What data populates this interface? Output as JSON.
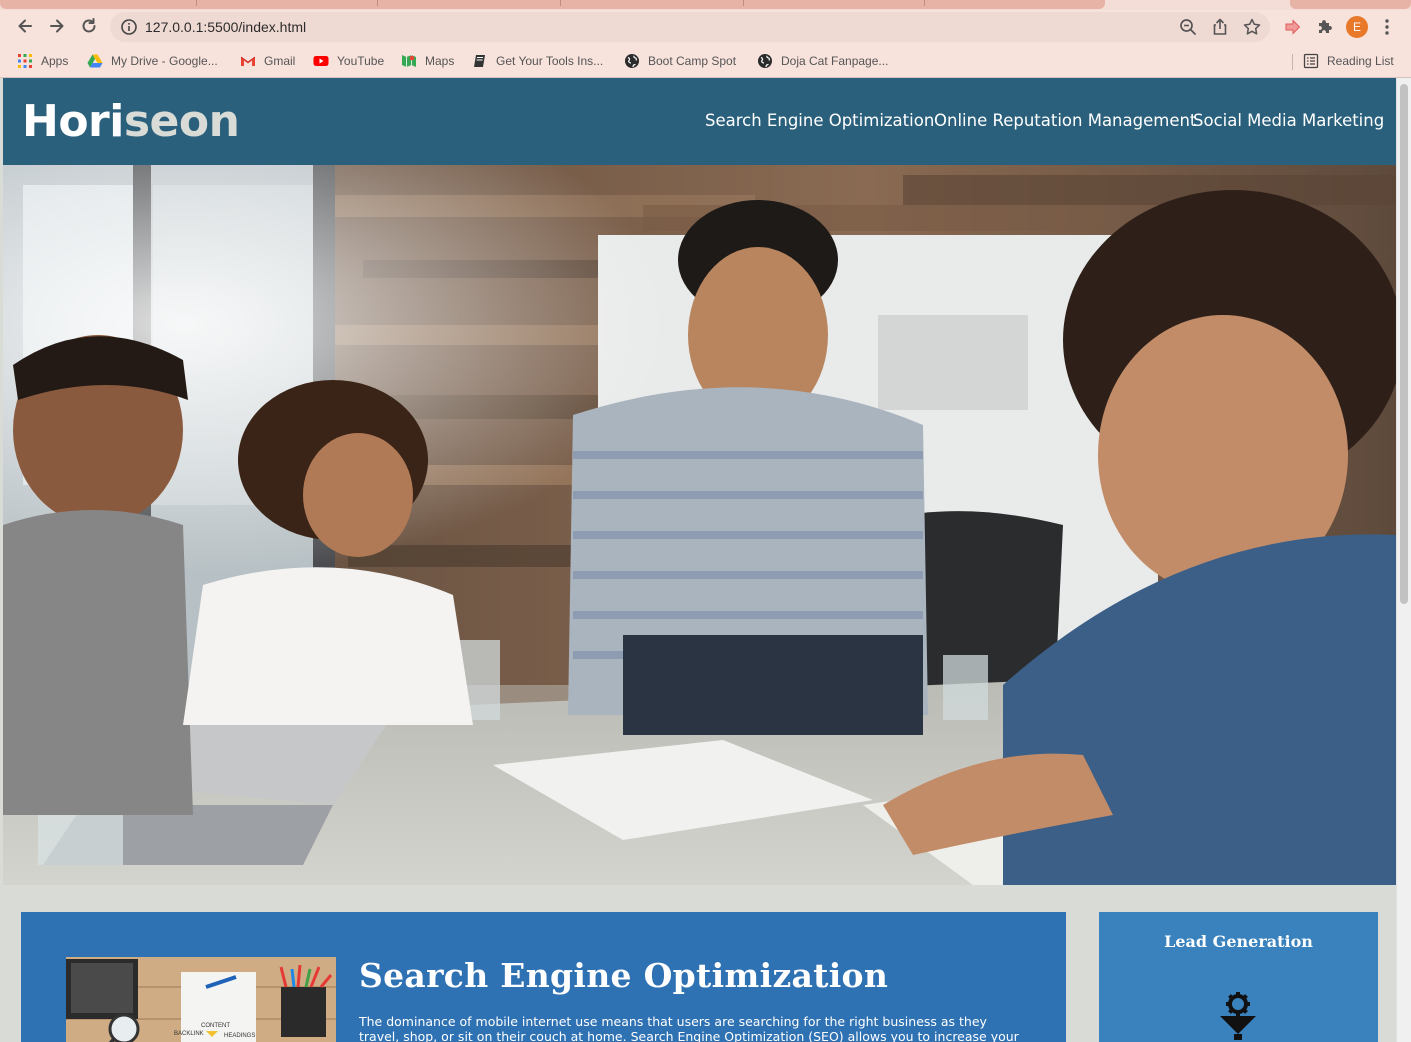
{
  "browser": {
    "url": "127.0.0.1:5500/index.html",
    "profile_initial": "E",
    "icons": {
      "back": "back-arrow-icon",
      "forward": "forward-arrow-icon",
      "reload": "reload-icon",
      "site_info": "info-icon",
      "zoom": "zoom-icon",
      "share": "share-icon",
      "bookmark": "star-icon",
      "extensions": "puzzle-icon",
      "menu": "kebab-menu-icon"
    }
  },
  "bookmarks": [
    {
      "label": "Apps",
      "icon": "apps-grid-icon"
    },
    {
      "label": "My Drive - Google...",
      "icon": "google-drive-icon"
    },
    {
      "label": "Gmail",
      "icon": "gmail-icon"
    },
    {
      "label": "YouTube",
      "icon": "youtube-icon"
    },
    {
      "label": "Maps",
      "icon": "maps-icon"
    },
    {
      "label": "Get Your Tools Ins...",
      "icon": "book-icon"
    },
    {
      "label": "Boot Camp Spot",
      "icon": "globe-icon"
    },
    {
      "label": "Doja Cat Fanpage...",
      "icon": "globe-icon"
    }
  ],
  "reading_list": {
    "label": "Reading List",
    "icon": "reading-list-icon"
  },
  "site": {
    "logo_main": "Hori",
    "logo_accent": "seon",
    "nav": [
      "Search Engine Optimization",
      "Online Reputation Management",
      "Social Media Marketing"
    ],
    "hero_alt": "hero-team-meeting-image",
    "content": {
      "title": "Search Engine Optimization",
      "body": "The dominance of mobile internet use means that users are searching for the right business as they travel, shop, or sit on their couch at home. Search Engine Optimization (SEO) allows you to increase your visibility and find",
      "thumb_texts": {
        "content": "CONTENT",
        "backlink": "BACKLINK",
        "headings": "HEADINGS"
      }
    },
    "aside": {
      "title": "Lead Generation",
      "icon": "lead-generation-icon"
    }
  },
  "colors": {
    "header_bg": "#2a607c",
    "content_bg": "#2f72b4",
    "aside_bg": "#3a82bd",
    "page_bg": "#d9dcd6",
    "chrome_bg": "#f8e2dc"
  }
}
